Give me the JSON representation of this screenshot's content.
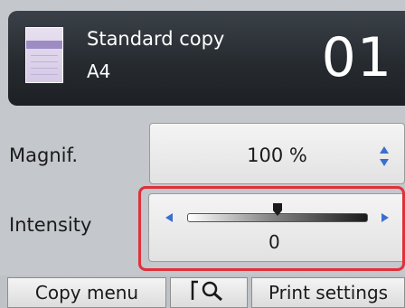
{
  "header": {
    "title": "Standard copy",
    "paper_size": "A4",
    "copies": "01",
    "icon": "copy-document-icon"
  },
  "magnification": {
    "label": "Magnif.",
    "value": "100 %",
    "icon": "up-down-arrows-icon"
  },
  "intensity": {
    "label": "Intensity",
    "value": "0",
    "level_fraction": 0.5,
    "left_icon": "left-arrow-icon",
    "right_icon": "right-arrow-icon"
  },
  "bottom_bar": {
    "copy_menu": "Copy menu",
    "preview_icon": "preview-magnifier-icon",
    "print_settings": "Print settings"
  },
  "colors": {
    "header_bg": "#262b30",
    "highlight": "#e0303a",
    "accent_arrows": "#3a6fd0"
  }
}
